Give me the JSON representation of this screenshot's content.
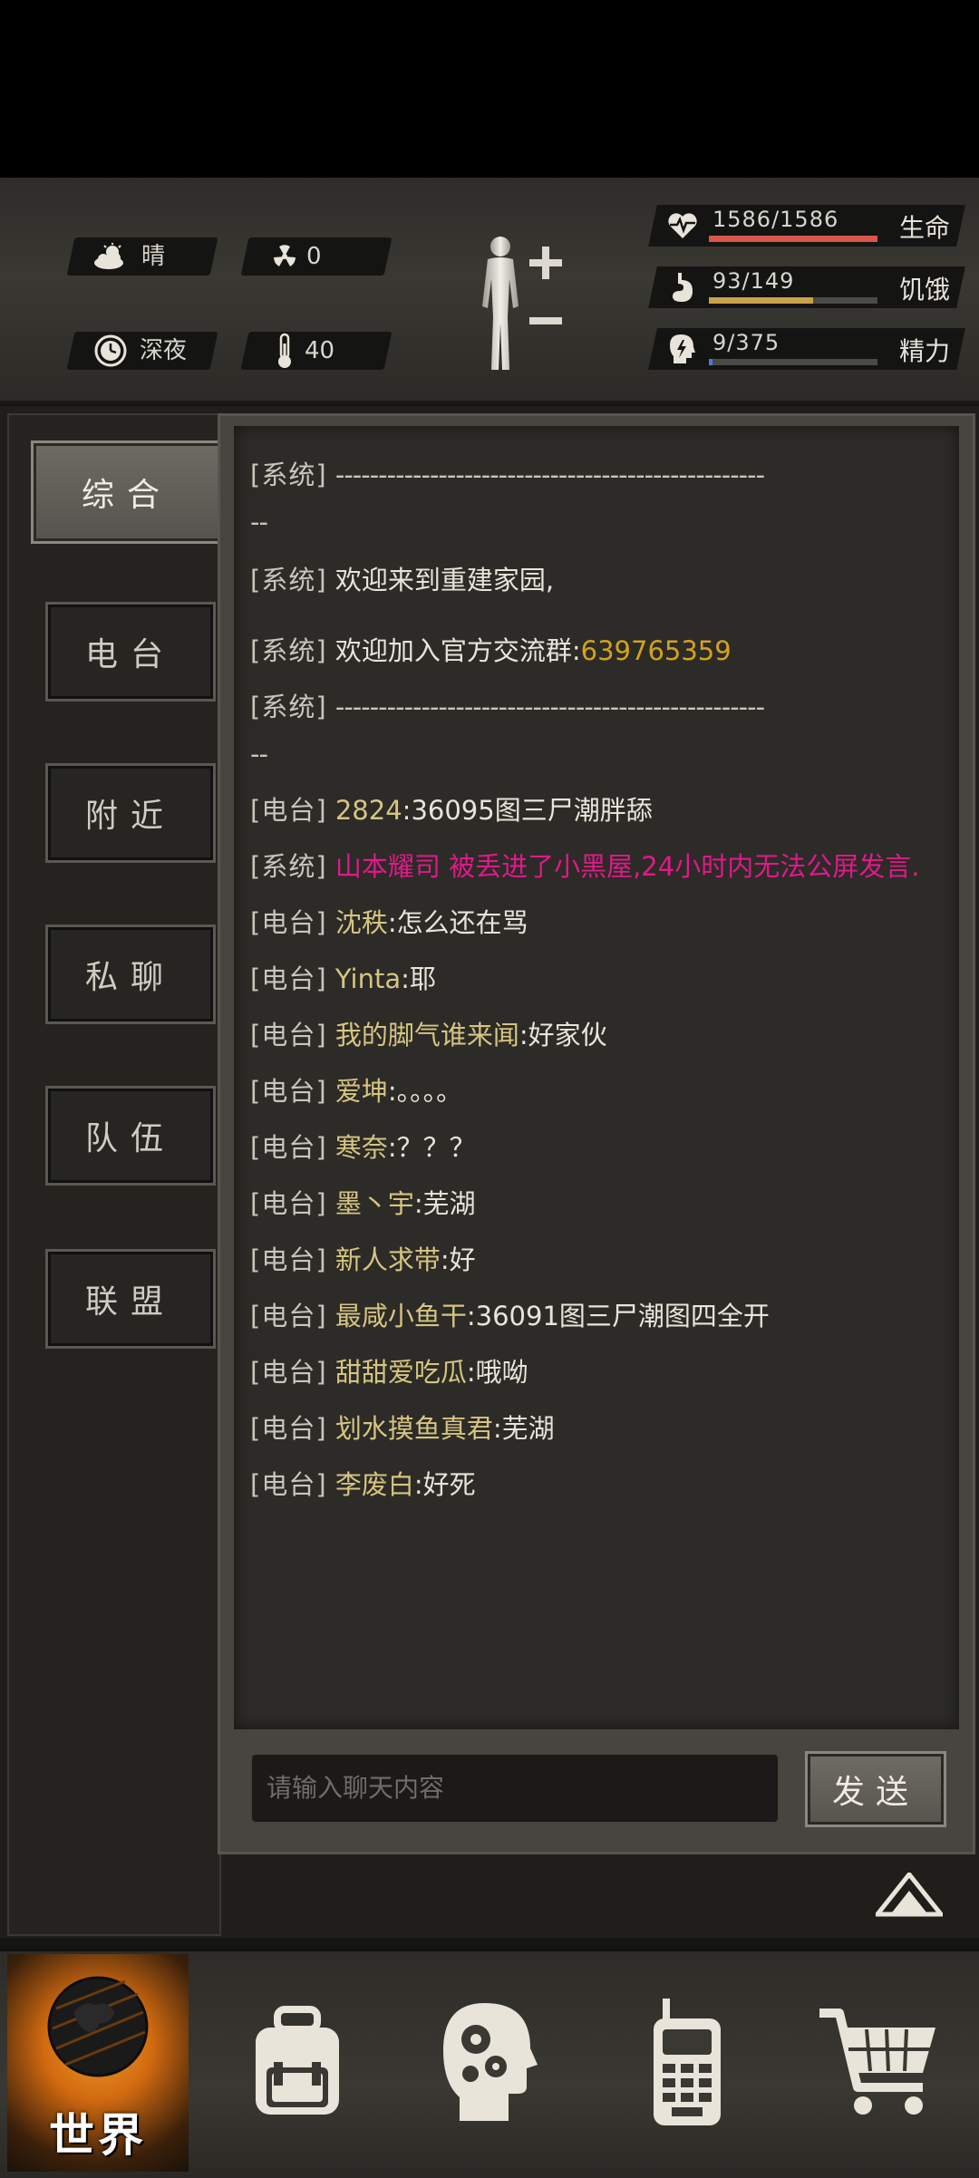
{
  "environment": {
    "weather": "晴",
    "radiation": "0",
    "time_of_day": "深夜",
    "temperature": "40"
  },
  "stats": [
    {
      "key": "life",
      "value": "1586/1586",
      "label": "生命",
      "fill_fraction": 1.0,
      "color": "#d8564a",
      "icon": "heart-pulse-icon"
    },
    {
      "key": "hunger",
      "value": "93/149",
      "label": "饥饿",
      "fill_fraction": 0.62,
      "color": "#c9a24a",
      "icon": "stomach-icon"
    },
    {
      "key": "energy",
      "value": "9/375",
      "label": "精力",
      "fill_fraction": 0.024,
      "color": "#4a7ad8",
      "icon": "head-energy-icon"
    }
  ],
  "tabs": [
    {
      "label": "综合",
      "active": true
    },
    {
      "label": "电台",
      "active": false
    },
    {
      "label": "附近",
      "active": false
    },
    {
      "label": "私聊",
      "active": false
    },
    {
      "label": "队伍",
      "active": false
    },
    {
      "label": "联盟",
      "active": false
    }
  ],
  "messages": [
    {
      "tag": "[系统]",
      "type": "divider",
      "text": "--------------------------------------------------",
      "cont": "--"
    },
    {
      "tag": "[系统]",
      "type": "system",
      "text": "欢迎来到重建家园,"
    },
    {
      "tag": "[系统]",
      "type": "system-num",
      "text": " 欢迎加入官方交流群:",
      "num": "639765359"
    },
    {
      "tag": "[系统]",
      "type": "divider",
      "text": "--------------------------------------------------",
      "cont": "--"
    },
    {
      "tag": "[电台]",
      "type": "chat-num",
      "who": "2824",
      "text": ":36095图三尸潮胖舔"
    },
    {
      "tag": "[系统]",
      "type": "warn",
      "text": "山本耀司 被丢进了小黑屋,24小时内无法公屏发言."
    },
    {
      "tag": "[电台]",
      "type": "chat",
      "who": "沈秩",
      "text": ":怎么还在骂"
    },
    {
      "tag": "[电台]",
      "type": "chat",
      "who": "Yinta",
      "text": ":耶"
    },
    {
      "tag": "[电台]",
      "type": "chat",
      "who": "我的脚气谁来闻",
      "text": ":好家伙"
    },
    {
      "tag": "[电台]",
      "type": "chat",
      "who": "爱坤",
      "text": ":。。。。"
    },
    {
      "tag": "[电台]",
      "type": "chat",
      "who": "寒奈",
      "text": ":？？？"
    },
    {
      "tag": "[电台]",
      "type": "chat",
      "who": "墨丶宇",
      "text": ":芜湖"
    },
    {
      "tag": "[电台]",
      "type": "chat",
      "who": "新人求带",
      "text": ":好"
    },
    {
      "tag": "[电台]",
      "type": "chat",
      "who": "最咸小鱼干",
      "text": ":36091图三尸潮图四全开"
    },
    {
      "tag": "[电台]",
      "type": "chat",
      "who": "甜甜爱吃瓜",
      "text": ":哦呦"
    },
    {
      "tag": "[电台]",
      "type": "chat",
      "who": "划水摸鱼真君",
      "text": ":芜湖"
    },
    {
      "tag": "[电台]",
      "type": "chat",
      "who": "李废白",
      "text": ":好死"
    }
  ],
  "chat_input": {
    "placeholder": "请输入聊天内容"
  },
  "send_label": "发送",
  "bottom_nav": [
    {
      "key": "world",
      "label": "世界",
      "icon": "globe-icon",
      "active": true
    },
    {
      "key": "backpack",
      "label": "",
      "icon": "backpack-icon"
    },
    {
      "key": "skills",
      "label": "",
      "icon": "brain-gears-icon"
    },
    {
      "key": "radio",
      "label": "",
      "icon": "walkie-talkie-icon"
    },
    {
      "key": "shop",
      "label": "",
      "icon": "shopping-cart-icon"
    }
  ]
}
